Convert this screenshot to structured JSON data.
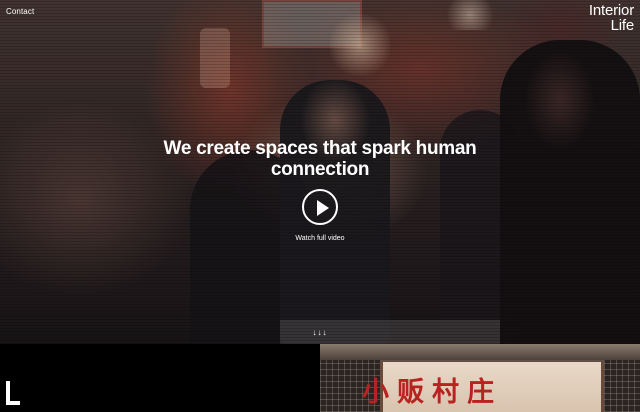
{
  "header": {
    "contact_label": "Contact",
    "brand_line1": "Interior",
    "brand_line2": "Life"
  },
  "hero": {
    "headline": "We create spaces that spark human connection",
    "play_icon": "play-icon",
    "watch_label": "Watch full video",
    "scroll_indicator": "↓↓↓"
  },
  "footer_logo": {
    "icon": "logo-l-mark"
  },
  "gallery": {
    "sign_text": "小贩村庄"
  },
  "colors": {
    "sign_red": "#b8231f",
    "text": "#ffffff",
    "background": "#000000"
  }
}
